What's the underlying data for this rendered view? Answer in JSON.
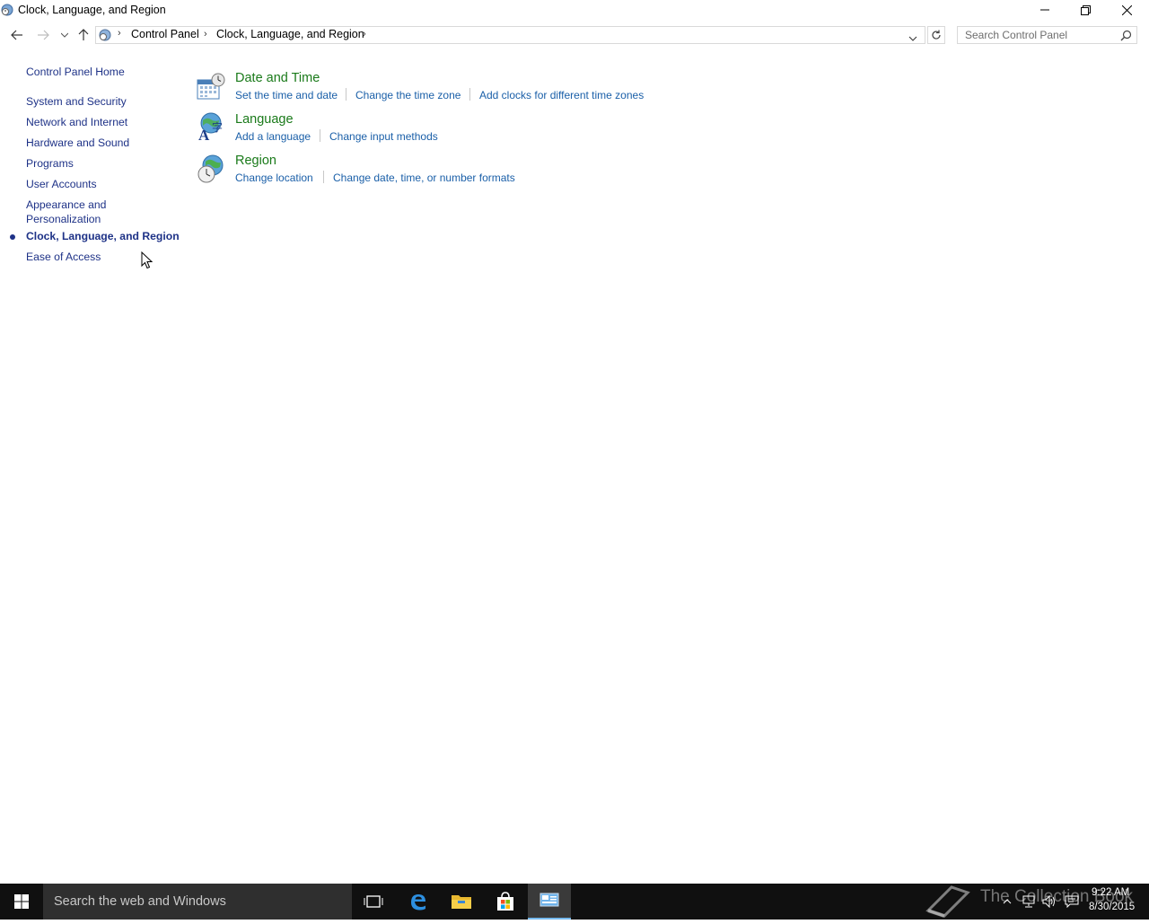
{
  "window": {
    "title": "Clock, Language, and Region",
    "minimize": "minimize",
    "restore": "restore",
    "close": "close"
  },
  "address_bar": {
    "breadcrumbs": [
      "Control Panel",
      "Clock, Language, and Region"
    ],
    "search_placeholder": "Search Control Panel"
  },
  "sidebar": {
    "home": "Control Panel Home",
    "items": [
      {
        "label": "System and Security"
      },
      {
        "label": "Network and Internet"
      },
      {
        "label": "Hardware and Sound"
      },
      {
        "label": "Programs"
      },
      {
        "label": "User Accounts"
      },
      {
        "label": "Appearance and",
        "label2": "Personalization"
      },
      {
        "label": "Clock, Language, and Region",
        "active": true
      },
      {
        "label": "Ease of Access"
      }
    ]
  },
  "categories": [
    {
      "title": "Date and Time",
      "icon": "calendar-clock-icon",
      "tasks": [
        "Set the time and date",
        "Change the time zone",
        "Add clocks for different time zones"
      ]
    },
    {
      "title": "Language",
      "icon": "language-icon",
      "tasks": [
        "Add a language",
        "Change input methods"
      ]
    },
    {
      "title": "Region",
      "icon": "globe-clock-icon",
      "tasks": [
        "Change location",
        "Change date, time, or number formats"
      ]
    }
  ],
  "taskbar": {
    "search_text": "Search the web and Windows",
    "time": "9:22 AM",
    "date": "8/30/2015",
    "watermark": "The Collection Book"
  },
  "colors": {
    "link": "#1a5fa8",
    "category_title": "#1a7a1a",
    "sidebar_link": "#1e3287",
    "taskbar": "#101010"
  }
}
